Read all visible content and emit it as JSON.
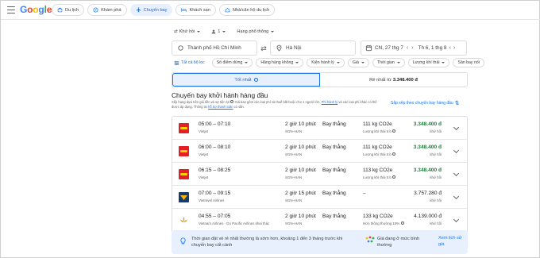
{
  "topbar": {
    "logo": "Google",
    "tabs": [
      {
        "label": "Du lịch",
        "icon": "travel-icon",
        "active": false
      },
      {
        "label": "Khám phá",
        "icon": "explore-icon",
        "active": false
      },
      {
        "label": "Chuyến bay",
        "icon": "flight-icon",
        "active": true
      },
      {
        "label": "Khách sạn",
        "icon": "hotel-icon",
        "active": false
      },
      {
        "label": "Nhà/căn hộ du lịch",
        "icon": "home-icon",
        "active": false
      }
    ]
  },
  "search": {
    "trip_type": "Khứ hồi",
    "passengers": "1",
    "cabin_class": "Hạng phổ thông",
    "origin": "Thành phố Hồ Chí Minh",
    "destination": "Hà Nội",
    "depart_date": "CN, 27 thg 7",
    "return_date": "Th 6, 1 thg 8"
  },
  "filters": {
    "all": "Tất cả bộ lọc",
    "chips": [
      "Số điểm dừng",
      "Hãng hàng không",
      "Kiện hành lý",
      "Giá",
      "Thời gian",
      "Lượng khí thải",
      "Sân bay nối"
    ]
  },
  "sort": {
    "best_label": "Tốt nhất",
    "cheapest_label": "Rẻ nhất",
    "cheapest_prefix": "từ",
    "cheapest_price": "3.348.400 đ"
  },
  "section": {
    "heading": "Chuyến bay khởi hành hàng đầu",
    "desc_start": "Xếp hạng dựa trên giá tiền và sự tiện lợi",
    "desc_mid": "Giá bao gồm các loại phí và thuế bắt buộc cho 1 người lớn.",
    "desc_link": "Phí hành lý",
    "desc_end": "và các loại phí khác có thể được áp dụng. Thông tin",
    "desc_link2": "hỗ trợ thanh toán",
    "desc_end2": "có sẵn.",
    "sort_link": "Sắp xếp theo chuyến bay hàng đầu"
  },
  "flights": [
    {
      "time": "05:00 – 07:10",
      "airline": "Vietjet",
      "logo": "vietjet",
      "duration": "2 giờ 10 phút",
      "route": "SGN–HAN",
      "stops": "Bay thẳng",
      "co2": "111 kg CO2e",
      "co2_note": "Lượng khí thải tr.b",
      "price": "3.348.400 đ",
      "price_type": "khứ hồi",
      "price_color": "green"
    },
    {
      "time": "06:00 – 08:10",
      "airline": "Vietjet",
      "logo": "vietjet",
      "duration": "2 giờ 10 phút",
      "route": "SGN–HAN",
      "stops": "Bay thẳng",
      "co2": "111 kg CO2e",
      "co2_note": "Lượng khí thải tr.b",
      "price": "3.348.400 đ",
      "price_type": "khứ hồi",
      "price_color": "green"
    },
    {
      "time": "06:15 – 08:25",
      "airline": "Vietjet",
      "logo": "vietjet",
      "duration": "2 giờ 10 phút",
      "route": "SGN–HAN",
      "stops": "Bay thẳng",
      "co2": "113 kg CO2e",
      "co2_note": "Lượng khí thải tr.b",
      "price": "3.348.400 đ",
      "price_type": "khứ hồi",
      "price_color": "green"
    },
    {
      "time": "07:00 – 09:15",
      "airline": "Vietravel Airlines",
      "logo": "vietravel",
      "duration": "2 giờ 15 phút",
      "route": "SGN–HAN",
      "stops": "Bay thẳng",
      "co2": "–",
      "co2_note": "",
      "price": "3.757.280 đ",
      "price_type": "khứ hồi",
      "price_color": "dark"
    },
    {
      "time": "04:55 – 07:05",
      "airline": "Vietnam Airlines · Do Pacific Airlines khai thác",
      "logo": "vna",
      "duration": "2 giờ 10 phút",
      "route": "SGN–HAN",
      "stops": "Bay thẳng",
      "co2": "133 kg CO2e",
      "co2_note": "Hơn thông thường 19%",
      "price": "4.139.000 đ",
      "price_type": "khứ hồi",
      "price_color": "dark"
    }
  ],
  "banner": {
    "text": "Thời gian đặt vé rẻ nhất thường là sớm hơn, khoảng 1 đến 3 tháng trước khi chuyến bay cất cánh",
    "price_note": "Giá đang ở mức bình thường",
    "history_link": "Xem lịch sử giá"
  },
  "colors": {
    "accent": "#1a73e8",
    "green": "#188038",
    "vietjet_red": "#e41f26",
    "light_blue": "#e8f0fe"
  }
}
